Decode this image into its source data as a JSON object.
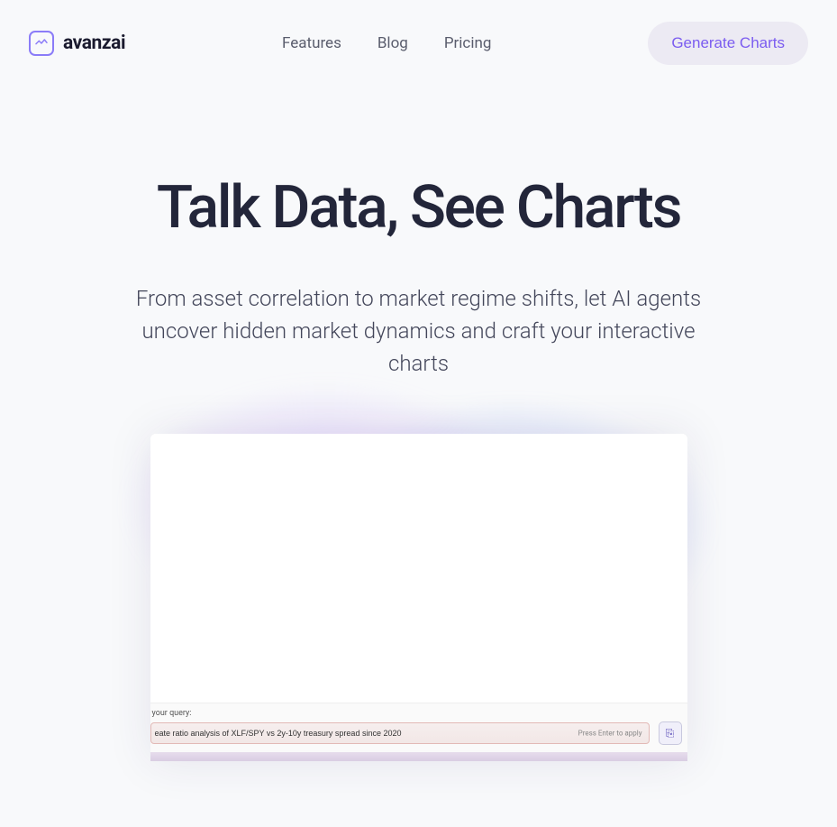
{
  "brand": {
    "name": "avanzai"
  },
  "nav": {
    "features": "Features",
    "blog": "Blog",
    "pricing": "Pricing"
  },
  "cta": {
    "label": "Generate Charts"
  },
  "hero": {
    "title": "Talk Data, See Charts",
    "subtitle": "From asset correlation to market regime shifts, let AI agents uncover hidden market dynamics and craft your interactive charts"
  },
  "preview": {
    "query_label": "your query:",
    "query_value": "eate ratio analysis of XLF/SPY vs 2y-10y treasury spread since 2020",
    "query_hint": "Press Enter to apply",
    "send_icon": "⎘"
  }
}
